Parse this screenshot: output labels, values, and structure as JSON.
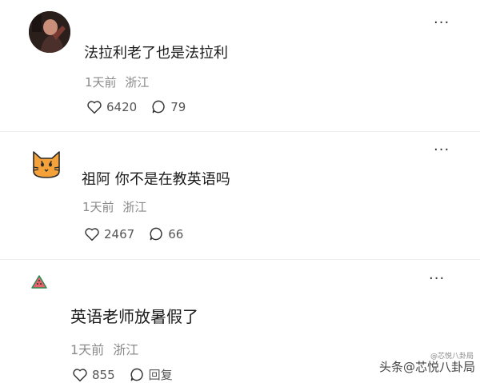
{
  "comments": [
    {
      "text": "法拉利老了也是法拉利",
      "time": "1天前",
      "location": "浙江",
      "likes": "6420",
      "replies": "79",
      "more": "···",
      "avatar_icon": "user-photo-avatar"
    },
    {
      "text": "祖阿 你不是在教英语吗",
      "time": "1天前",
      "location": "浙江",
      "likes": "2467",
      "replies": "66",
      "more": "···",
      "avatar_icon": "cat-avatar-icon"
    },
    {
      "text": "英语老师放暑假了",
      "time": "1天前",
      "location": "浙江",
      "likes": "855",
      "replies": "回复",
      "more": "···",
      "avatar_icon": "watermelon-avatar-icon"
    }
  ],
  "watermark": "头条@芯悦八卦局",
  "watermark_small": "@芯悦八卦局",
  "colors": {
    "meta": "#8a8a8a",
    "cat": "#f4a13a",
    "watermelon": "#e7606a"
  }
}
